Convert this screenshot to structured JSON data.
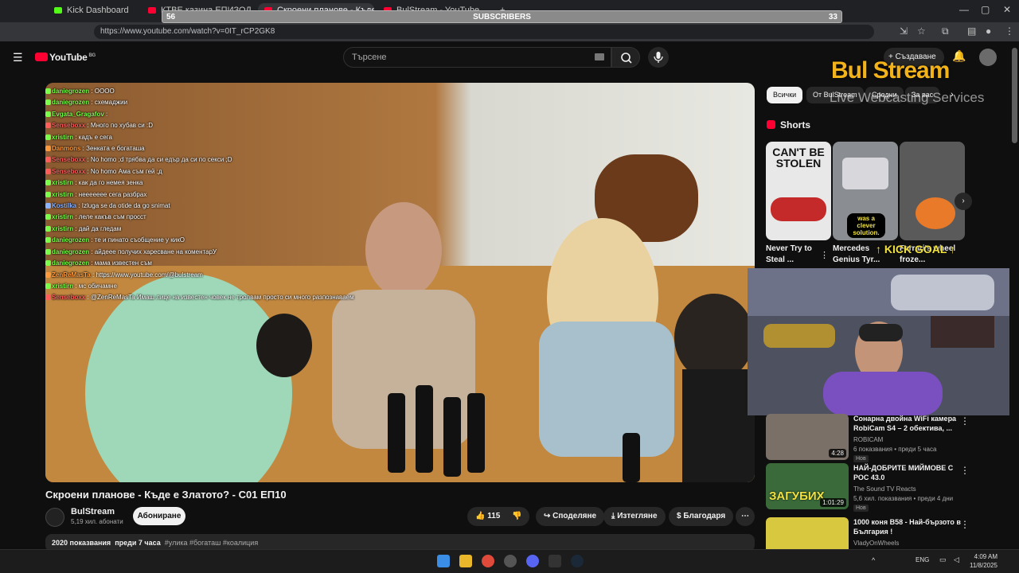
{
  "browser": {
    "tabs": [
      {
        "label": "Kick Dashboard"
      },
      {
        "label": "КТВЕ казина ЕПИЗОД 10 'А'"
      },
      {
        "label": "Скроени планове - Къде е З"
      },
      {
        "label": "BulStream - YouTube"
      }
    ],
    "url": "https://www.youtube.com/watch?v=0IT_rCP2GK8"
  },
  "overlay": {
    "subs_label": "SUBSCRIBERS",
    "subs_left": "56",
    "subs_right": "33",
    "kick_goal": "KICK GOAL"
  },
  "header": {
    "logo": "YouTube",
    "logo_region": "BG",
    "search_placeholder": "Търсене",
    "create_label": "Създаване"
  },
  "chat": [
    {
      "user": "daniegrozen",
      "text": "ОООО",
      "color": "#7cff4a"
    },
    {
      "user": "daniegrozen",
      "text": "схемаджии",
      "color": "#7cff4a"
    },
    {
      "user": "Evgata_Gragafov",
      "text": "",
      "color": "#7cff4a"
    },
    {
      "user": "Senseboxx",
      "text": "Много по хубав си :D",
      "color": "#ff5c5c"
    },
    {
      "user": "xristirn",
      "text": "кадъ е сега",
      "color": "#7cff4a"
    },
    {
      "user": "Danmons",
      "text": "Зенката е богаташа",
      "color": "#ff9a3c"
    },
    {
      "user": "Senseboxx",
      "text": "No homo ;d трябва да си едър да си по секси ;D",
      "color": "#ff5c5c"
    },
    {
      "user": "Senseboxx",
      "text": "No homo Ама съм гей ;д",
      "color": "#ff5c5c"
    },
    {
      "user": "xristirn",
      "text": "как да го немея зенка",
      "color": "#7cff4a"
    },
    {
      "user": "xristirn",
      "text": "неееееее сега разбрах",
      "color": "#7cff4a"
    },
    {
      "user": "Kostilka",
      "text": "Izluga se da otide da go snimat",
      "color": "#8ab4ff"
    },
    {
      "user": "xristirn",
      "text": "леле какъв съм просст",
      "color": "#7cff4a"
    },
    {
      "user": "xristirn",
      "text": "дай да гледам",
      "color": "#7cff4a"
    },
    {
      "user": "daniegrozen",
      "text": "те и пинато съобщение у кикО",
      "color": "#7cff4a"
    },
    {
      "user": "daniegrozen",
      "text": "айдеее получих харесване на коментарУ",
      "color": "#7cff4a"
    },
    {
      "user": "daniegrozen",
      "text": "мама известен съм",
      "color": "#7cff4a"
    },
    {
      "user": "ZenReMasTa",
      "text": "https://www.youtube.com/@bulstream",
      "color": "#ff9a3c"
    },
    {
      "user": "xristirn",
      "text": "мс обичамне",
      "color": "#7cff4a"
    },
    {
      "user": "Senseboxx",
      "text": "@ZenReMasTa Имаш лице на известен човек не тролвам просто си много разпознаваем",
      "color": "#ff5c5c"
    }
  ],
  "video": {
    "title": "Скроени планове - Къде е Златото? - С01 ЕП10",
    "channel": "BulStream",
    "channel_subs": "5,19 хил. абонати",
    "subscribe": "Абониране",
    "likes": "115",
    "share": "Споделяне",
    "download": "Изтегляне",
    "thanks": "Благодаря",
    "views": "2020 показвания",
    "age": "преди 7 часа",
    "tags": "#улика #богаташ #коалиция"
  },
  "sidebar": {
    "chips": [
      "Всички",
      "От BulStream",
      "Сродни",
      "За вас"
    ],
    "shorts_title": "Shorts",
    "shorts": [
      {
        "title": "Never Try to Steal ...",
        "overlay": "CAN'T BE STOLEN"
      },
      {
        "title": "Mercedes Genius Tyr...",
        "overlay": "was a clever solution."
      },
      {
        "title": "Ferrari's wheel froze...",
        "overlay": ""
      }
    ],
    "recommended": [
      {
        "title": "Сонарна двойна WiFi камера RobiCam S4 – 2 обектива, ...",
        "channel": "ROBICAM",
        "views": "6 показвания",
        "age": "преди 5 часа",
        "badge": "Нов",
        "duration": "4:28",
        "thumb_color": "#7a7068"
      },
      {
        "title": "НАЙ-ДОБРИТЕ МИЙМОВЕ С РОС 43.0",
        "channel": "The Sound TV Reacts",
        "views": "5,6 хил. показвания",
        "age": "преди 4 дни",
        "badge": "Нов",
        "duration": "1:01:29",
        "thumb_color": "#3a6a3a",
        "thumb_text": "ЗАГУБИХ"
      },
      {
        "title": "1000 коня B58 - Най-бързото в България !",
        "channel": "VladyOnWheels",
        "views": "",
        "age": "",
        "badge": "",
        "duration": "",
        "thumb_color": "#d8c840"
      }
    ]
  },
  "brand": {
    "name": "Bul Stream",
    "tagline": "Live Webcasting Services"
  },
  "taskbar": {
    "lang": "ENG",
    "time": "4:09 AM",
    "date": "11/8/2025"
  }
}
